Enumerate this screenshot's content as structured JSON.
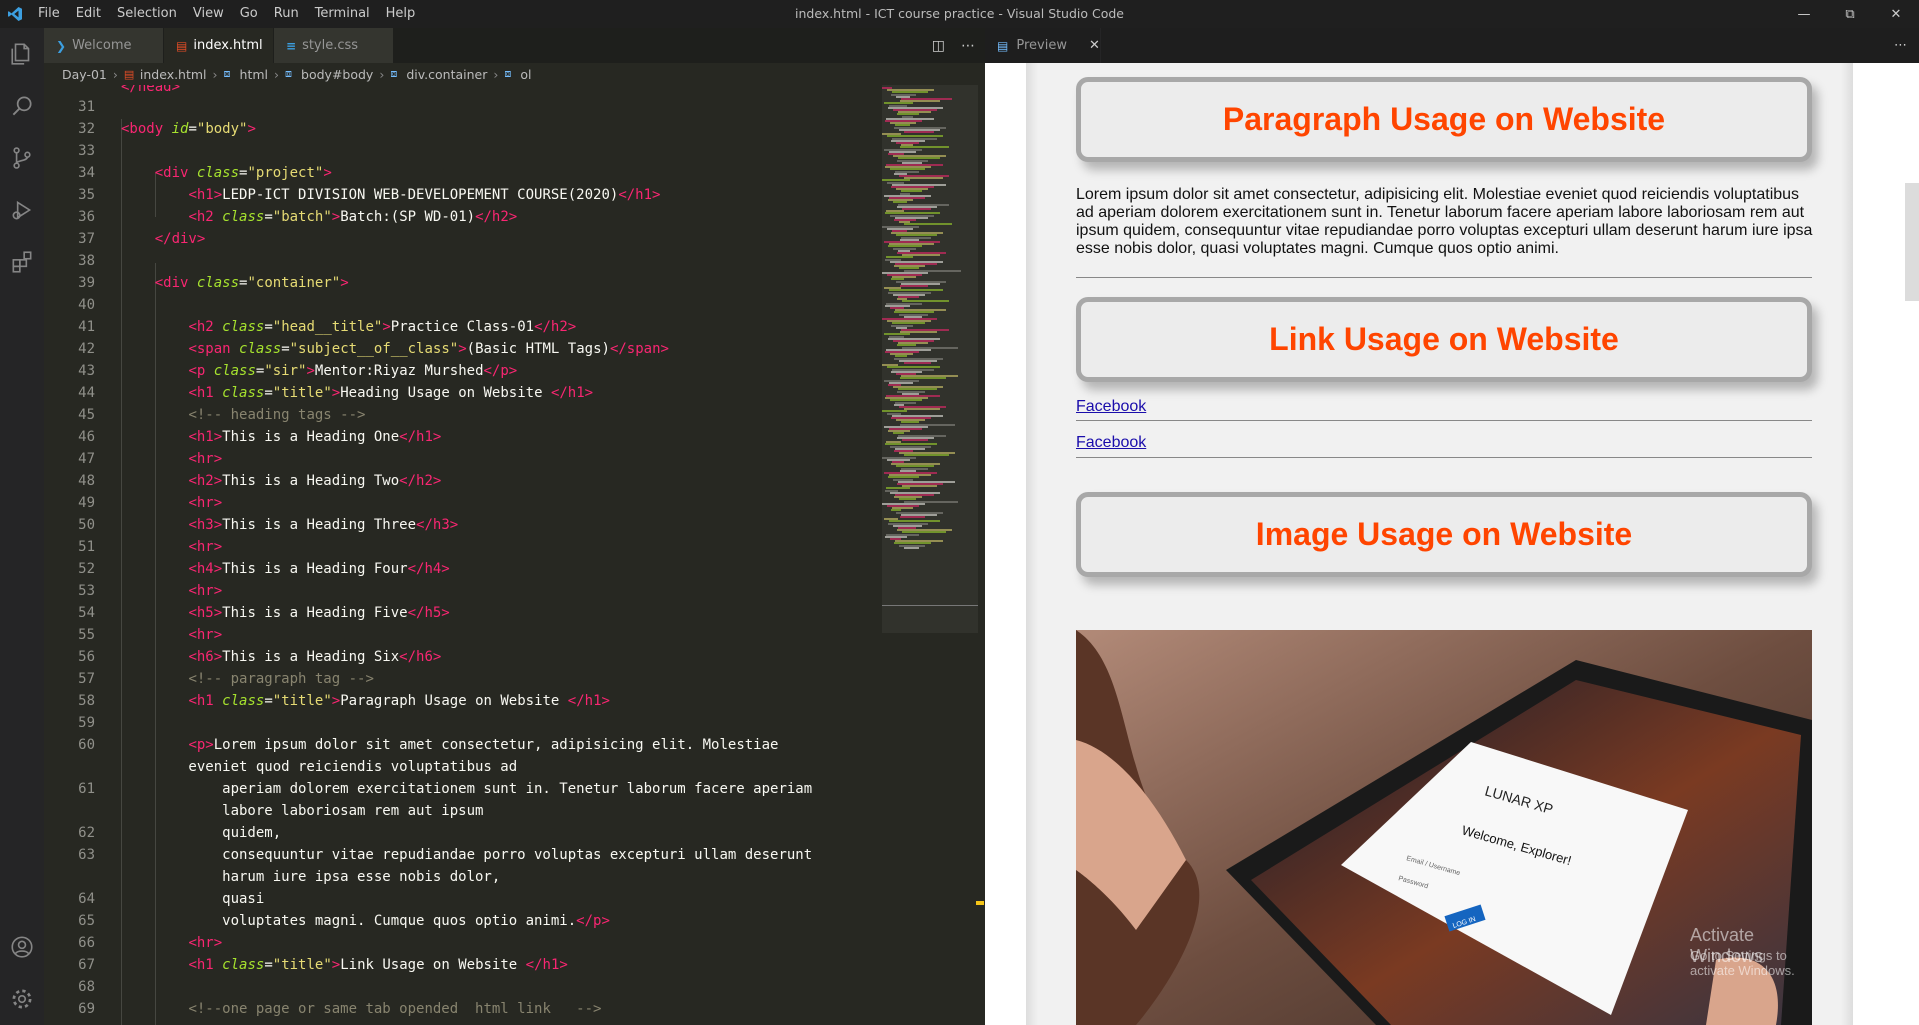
{
  "titlebar": {
    "menu": [
      "File",
      "Edit",
      "Selection",
      "View",
      "Go",
      "Run",
      "Terminal",
      "Help"
    ],
    "window_title": "index.html - ICT course practice - Visual Studio Code"
  },
  "tabs": [
    {
      "label": "Welcome"
    },
    {
      "label": "index.html"
    },
    {
      "label": "style.css"
    }
  ],
  "breadcrumb": [
    "Day-01",
    "index.html",
    "html",
    "body#body",
    "div.container",
    "ol"
  ],
  "preview": {
    "tab_label": "Preview",
    "titles": [
      "Paragraph Usage on Website",
      "Link Usage on Website",
      "Image Usage on Website"
    ],
    "paragraph": "Lorem ipsum dolor sit amet consectetur, adipisicing elit. Molestiae eveniet quod reiciendis voluptatibus ad aperiam dolorem exercitationem sunt in. Tenetur laborum facere aperiam labore laboriosam rem aut ipsum quidem, consequuntur vitae repudiandae porro voluptas excepturi ullam deserunt harum iure ipsa esse nobis dolor, quasi voluptates magni. Cumque quos optio animi.",
    "links": [
      "Facebook",
      "Facebook"
    ],
    "image_text": {
      "brand": "LUNAR XP",
      "welcome": "Welcome, Explorer!",
      "email_ph": "Email / Username",
      "password_ph": "Password",
      "login": "LOG IN"
    },
    "watermark": {
      "line1": "Activate Windows",
      "line2": "Go to Settings to activate Windows."
    }
  },
  "code_lines": [
    {
      "n": "",
      "h": "<span class='t'>&lt;/head&gt;</span>",
      "i": 0
    },
    {
      "n": "31",
      "h": "",
      "i": 0
    },
    {
      "n": "32",
      "h": "<span class='t'>&lt;body</span> <span class='a'>id</span>=<span class='s'>\"body\"</span><span class='t'>&gt;</span>",
      "i": 0
    },
    {
      "n": "33",
      "h": "",
      "i": 0
    },
    {
      "n": "34",
      "h": "    <span class='t'>&lt;div</span> <span class='a'>class</span>=<span class='s'>\"project\"</span><span class='t'>&gt;</span>",
      "i": 0
    },
    {
      "n": "35",
      "h": "        <span class='t'>&lt;h1&gt;</span>LEDP-ICT DIVISION WEB-DEVELOPEMENT COURSE(2020)<span class='t'>&lt;/h1&gt;</span>",
      "i": 0
    },
    {
      "n": "36",
      "h": "        <span class='t'>&lt;h2</span> <span class='a'>class</span>=<span class='s'>\"batch\"</span><span class='t'>&gt;</span>Batch:(SP WD-01)<span class='t'>&lt;/h2&gt;</span>",
      "i": 0
    },
    {
      "n": "37",
      "h": "    <span class='t'>&lt;/div&gt;</span>",
      "i": 0
    },
    {
      "n": "38",
      "h": "",
      "i": 0
    },
    {
      "n": "39",
      "h": "    <span class='t'>&lt;div</span> <span class='a'>class</span>=<span class='s'>\"container\"</span><span class='t'>&gt;</span>",
      "i": 0
    },
    {
      "n": "40",
      "h": "",
      "i": 0
    },
    {
      "n": "41",
      "h": "        <span class='t'>&lt;h2</span> <span class='a'>class</span>=<span class='s'>\"head__title\"</span><span class='t'>&gt;</span>Practice Class-01<span class='t'>&lt;/h2&gt;</span>",
      "i": 0
    },
    {
      "n": "42",
      "h": "        <span class='t'>&lt;span</span> <span class='a'>class</span>=<span class='s'>\"subject__of__class\"</span><span class='t'>&gt;</span>(Basic HTML Tags)<span class='t'>&lt;/span&gt;</span>",
      "i": 0
    },
    {
      "n": "43",
      "h": "        <span class='t'>&lt;p</span> <span class='a'>class</span>=<span class='s'>\"sir\"</span><span class='t'>&gt;</span>Mentor:Riyaz Murshed<span class='t'>&lt;/p&gt;</span>",
      "i": 0
    },
    {
      "n": "44",
      "h": "        <span class='t'>&lt;h1</span> <span class='a'>class</span>=<span class='s'>\"title\"</span><span class='t'>&gt;</span>Heading Usage on Website <span class='t'>&lt;/h1&gt;</span>",
      "i": 0
    },
    {
      "n": "45",
      "h": "        <span class='c'>&lt;!-- heading tags --&gt;</span>",
      "i": 0
    },
    {
      "n": "46",
      "h": "        <span class='t'>&lt;h1&gt;</span>This is a Heading One<span class='t'>&lt;/h1&gt;</span>",
      "i": 0
    },
    {
      "n": "47",
      "h": "        <span class='t'>&lt;hr&gt;</span>",
      "i": 0
    },
    {
      "n": "48",
      "h": "        <span class='t'>&lt;h2&gt;</span>This is a Heading Two<span class='t'>&lt;/h2&gt;</span>",
      "i": 0
    },
    {
      "n": "49",
      "h": "        <span class='t'>&lt;hr&gt;</span>",
      "i": 0
    },
    {
      "n": "50",
      "h": "        <span class='t'>&lt;h3&gt;</span>This is a Heading Three<span class='t'>&lt;/h3&gt;</span>",
      "i": 0
    },
    {
      "n": "51",
      "h": "        <span class='t'>&lt;hr&gt;</span>",
      "i": 0
    },
    {
      "n": "52",
      "h": "        <span class='t'>&lt;h4&gt;</span>This is a Heading Four<span class='t'>&lt;/h4&gt;</span>",
      "i": 0
    },
    {
      "n": "53",
      "h": "        <span class='t'>&lt;hr&gt;</span>",
      "i": 0
    },
    {
      "n": "54",
      "h": "        <span class='t'>&lt;h5&gt;</span>This is a Heading Five<span class='t'>&lt;/h5&gt;</span>",
      "i": 0
    },
    {
      "n": "55",
      "h": "        <span class='t'>&lt;hr&gt;</span>",
      "i": 0
    },
    {
      "n": "56",
      "h": "        <span class='t'>&lt;h6&gt;</span>This is a Heading Six<span class='t'>&lt;/h6&gt;</span>",
      "i": 0
    },
    {
      "n": "57",
      "h": "        <span class='c'>&lt;!-- paragraph tag --&gt;</span>",
      "i": 0
    },
    {
      "n": "58",
      "h": "        <span class='t'>&lt;h1</span> <span class='a'>class</span>=<span class='s'>\"title\"</span><span class='t'>&gt;</span>Paragraph Usage on Website <span class='t'>&lt;/h1&gt;</span>",
      "i": 0
    },
    {
      "n": "59",
      "h": "",
      "i": 0
    },
    {
      "n": "60",
      "h": "        <span class='t'>&lt;p&gt;</span>Lorem ipsum dolor sit amet consectetur, adipisicing elit. Molestiae",
      "i": 0
    },
    {
      "n": "",
      "h": "        eveniet quod reiciendis voluptatibus ad",
      "i": 0
    },
    {
      "n": "61",
      "h": "            aperiam dolorem exercitationem sunt in. Tenetur laborum facere aperiam",
      "i": 0
    },
    {
      "n": "",
      "h": "            labore laboriosam rem aut ipsum",
      "i": 0
    },
    {
      "n": "62",
      "h": "            quidem,",
      "i": 0
    },
    {
      "n": "63",
      "h": "            consequuntur vitae repudiandae porro voluptas excepturi ullam deserunt",
      "i": 0
    },
    {
      "n": "",
      "h": "            harum iure ipsa esse nobis dolor,",
      "i": 0
    },
    {
      "n": "64",
      "h": "            quasi",
      "i": 0
    },
    {
      "n": "65",
      "h": "            voluptates magni. Cumque quos optio animi.<span class='t'>&lt;/p&gt;</span>",
      "i": 0
    },
    {
      "n": "66",
      "h": "        <span class='t'>&lt;hr&gt;</span>",
      "i": 0
    },
    {
      "n": "67",
      "h": "        <span class='t'>&lt;h1</span> <span class='a'>class</span>=<span class='s'>\"title\"</span><span class='t'>&gt;</span>Link Usage on Website <span class='t'>&lt;/h1&gt;</span>",
      "i": 0
    },
    {
      "n": "68",
      "h": "",
      "i": 0
    },
    {
      "n": "69",
      "h": "        <span class='c'>&lt;!--one page or same tab opended  html link   --&gt;</span>",
      "i": 0
    }
  ],
  "colors": {
    "tag": "#f92672",
    "attr": "#a6e22e",
    "string": "#e6db74",
    "comment": "#88846f",
    "preview_title": "#ff4500",
    "link": "#1a0dab"
  },
  "icons": [
    "vscode-logo-icon",
    "explorer-icon",
    "search-icon",
    "source-control-icon",
    "run-debug-icon",
    "extensions-icon",
    "account-icon",
    "settings-gear-icon",
    "split-editor-icon",
    "more-actions-icon",
    "close-icon",
    "preview-icon"
  ]
}
